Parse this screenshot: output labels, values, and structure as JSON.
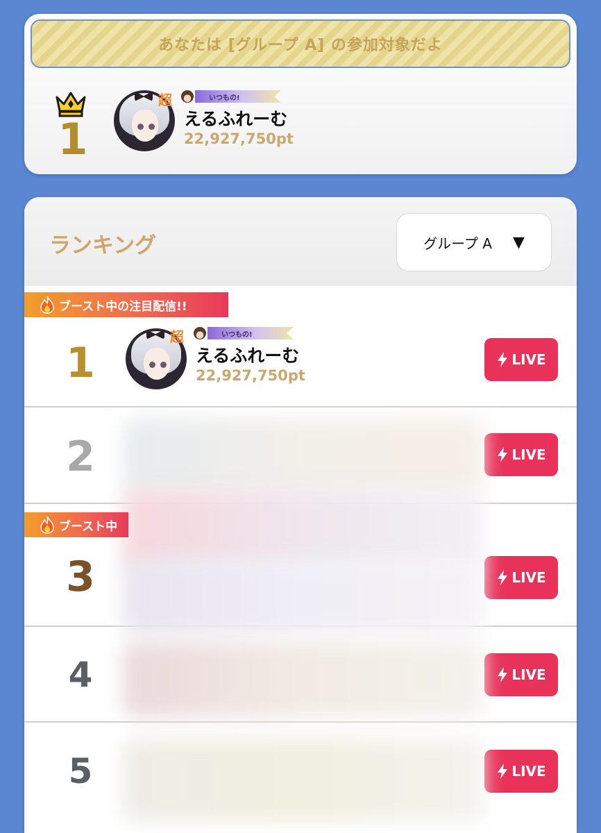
{
  "banner": {
    "text": "あなたは [グループ A] の参加対象だよ"
  },
  "my_entry": {
    "rank": "1",
    "super_badge": "超",
    "ribbon_label": "いつもの!",
    "name": "えるふれーむ",
    "points": "22,927,750pt"
  },
  "ranking": {
    "title": "ランキング",
    "group_select": {
      "value": "グループ A",
      "arrow": "▼"
    },
    "boost_label": "ブースト中の注目配信!!",
    "boost_label_partial": "ブースト中",
    "live_label": "LIVE",
    "rows": [
      {
        "rank": "1",
        "rank_color": "#b8912e",
        "name": "えるふれーむ",
        "points": "22,927,750pt",
        "super_badge": "超",
        "ribbon_label": "いつもの!",
        "boosted": true
      },
      {
        "rank": "2",
        "rank_color": "#a9a9a9",
        "boosted": false
      },
      {
        "rank": "3",
        "rank_color": "#7a5228",
        "boosted": true
      },
      {
        "rank": "4",
        "rank_color": "#5a5f66",
        "boosted": false
      },
      {
        "rank": "5",
        "rank_color": "#5a5f66",
        "boosted": false
      }
    ]
  },
  "colors": {
    "background": "#5a86d2",
    "accent_gold": "#c8a86e",
    "live_red": "#e8325a",
    "boost_orange": "#f29e2a"
  },
  "icons": [
    "crown-icon",
    "flame-icon",
    "bolt-icon",
    "dropdown-arrow-icon"
  ]
}
